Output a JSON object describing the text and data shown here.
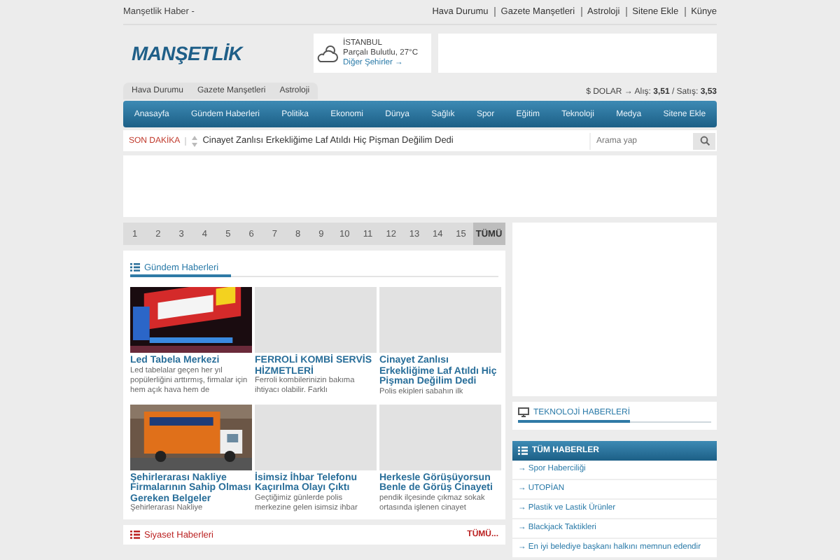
{
  "top_bar": {
    "site_label": "Manşetlik Haber -",
    "links": [
      "Hava Durumu",
      "Gazete Manşetleri",
      "Astroloji",
      "Sitene Ekle",
      "Künye"
    ]
  },
  "header": {
    "logo": "MANŞETLİK",
    "weather": {
      "city": "İSTANBUL",
      "condition": "Parçalı Bulutlu, 27°C",
      "link": "Diğer Şehirler →"
    }
  },
  "sub_tabs": [
    "Hava Durumu",
    "Gazete Manşetleri",
    "Astroloji"
  ],
  "currency": "$ DOLAR → Alış: **3,51** / Satış: **3,53**",
  "nav": [
    "Anasayfa",
    "Gündem Haberleri",
    "Politika",
    "Ekonomi",
    "Dünya",
    "Sağlık",
    "Spor",
    "Eğitim",
    "Teknoloji",
    "Medya",
    "Sitene Ekle"
  ],
  "breaking": {
    "label": "SON DAKİKA",
    "text": "Cinayet Zanlısı Erkekliğime Laf Atıldı Hiç Pişman Değilim Dedi",
    "search": {
      "placeholder": "Arama yap"
    }
  },
  "pages": [
    {
      "label": "1",
      "selected": false
    },
    {
      "label": "2",
      "selected": false
    },
    {
      "label": "3",
      "selected": false
    },
    {
      "label": "4",
      "selected": false
    },
    {
      "label": "5",
      "selected": false
    },
    {
      "label": "6",
      "selected": false
    },
    {
      "label": "7",
      "selected": false
    },
    {
      "label": "8",
      "selected": false
    },
    {
      "label": "9",
      "selected": false
    },
    {
      "label": "10",
      "selected": false
    },
    {
      "label": "11",
      "selected": false
    },
    {
      "label": "12",
      "selected": false
    },
    {
      "label": "13",
      "selected": false
    },
    {
      "label": "14",
      "selected": false
    },
    {
      "label": "15",
      "selected": false
    },
    {
      "label": "TÜMÜ",
      "selected": true
    }
  ],
  "gundem": {
    "title": "Gündem Haberleri",
    "items": [
      {
        "kind": "picture",
        "title": "Led Tabela Merkezi",
        "excerpt": "Led tabelalar geçen her yıl popülerliğini arttırmış, firmalar için hem açık hava hem de"
      },
      {
        "kind": "placeholder",
        "title": "FERROLİ KOMBİ SERVİS HİZMETLERİ",
        "excerpt": " Ferroli kombilerinizin bakıma ihtiyacı olabilir. Farklı"
      },
      {
        "kind": "placeholder",
        "title": "Cinayet Zanlısı Erkekliğime Laf Atıldı Hiç Pişman Değilim Dedi",
        "excerpt": "Polis ekipleri sabahın ilk"
      },
      {
        "kind": "picture",
        "title": "Şehirlerarası Nakliye Firmalarının Sahip Olması Gereken Belgeler",
        "excerpt": "Şehirlerarası Nakliye"
      },
      {
        "kind": "placeholder",
        "title": "İsimsiz İhbar Telefonu Kaçırılma Olayı Çıktı",
        "excerpt": "Geçtiğimiz günlerde polis merkezine gelen isimsiz ihbar"
      },
      {
        "kind": "placeholder",
        "title": "Herkesle Görüşüyorsun Benle de Görüş Cinayeti",
        "excerpt": "pendik ilçesinde çıkmaz sokak ortasında işlenen cinayet"
      }
    ]
  },
  "siyaset": {
    "title": "Siyaset Haberleri",
    "more": "TÜMÜ..."
  },
  "sidebar": {
    "teknoloji": {
      "title": "TEKNOLOJİ HABERLERİ"
    },
    "tum": {
      "title": "TÜM HABERLER",
      "items": [
        "→ Spor Haberciliği",
        "→ UTOPİAN",
        "→ Plastik ve Lastik Ürünler",
        "→ Blackjack Taktikleri",
        "→ En iyi belediye başkanı halkını memnun edendir"
      ]
    }
  }
}
